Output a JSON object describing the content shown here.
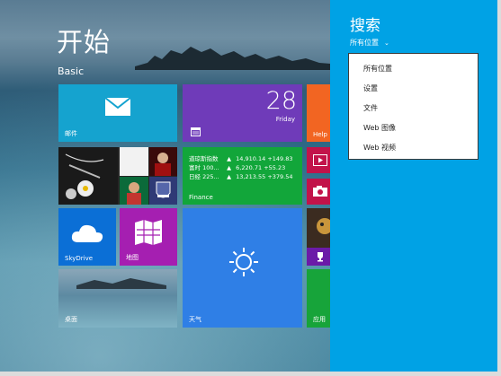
{
  "start": {
    "title": "开始",
    "group": "Basic"
  },
  "tiles": {
    "mail": {
      "label": "邮件",
      "icon": "mail-icon"
    },
    "calendar": {
      "day": "28",
      "weekday": "Friday",
      "icon": "calendar-icon"
    },
    "help": {
      "label": "Help",
      "icon": "help-icon"
    },
    "people": {
      "icon": "people-icon"
    },
    "finance": {
      "label": "Finance",
      "rows": [
        {
          "name": "道琼斯指数",
          "arrow": "▲",
          "value": "14,910.14",
          "change": "+149.83"
        },
        {
          "name": "富时 100...",
          "arrow": "▲",
          "value": "6,220.71",
          "change": "+55.23"
        },
        {
          "name": "日经 225...",
          "arrow": "▲",
          "value": "13,213.55",
          "change": "+379.54"
        }
      ]
    },
    "video": {
      "icon": "video-icon"
    },
    "camera": {
      "icon": "camera-icon"
    },
    "skydrive": {
      "label": "SkyDrive",
      "icon": "cloud-icon"
    },
    "maps": {
      "label": "地图",
      "icon": "map-icon"
    },
    "weather": {
      "label": "天气",
      "icon": "sun-icon"
    },
    "photo": {
      "icon": "trophy-icon"
    },
    "desktop": {
      "label": "桌面"
    },
    "store": {
      "label": "应用"
    }
  },
  "search": {
    "title": "搜索",
    "scope": "所有位置",
    "options": [
      "所有位置",
      "设置",
      "文件",
      "Web 图像",
      "Web 视频"
    ]
  },
  "colors": {
    "charm": "#00a2e5",
    "mail": "#15a3cf",
    "calendar": "#6f3bb9",
    "finance": "#12a63a",
    "skydrive": "#0b6fd6",
    "maps": "#a51fb1",
    "weather": "#2f7fe6",
    "help": "#f26522",
    "video": "#c2134a"
  }
}
